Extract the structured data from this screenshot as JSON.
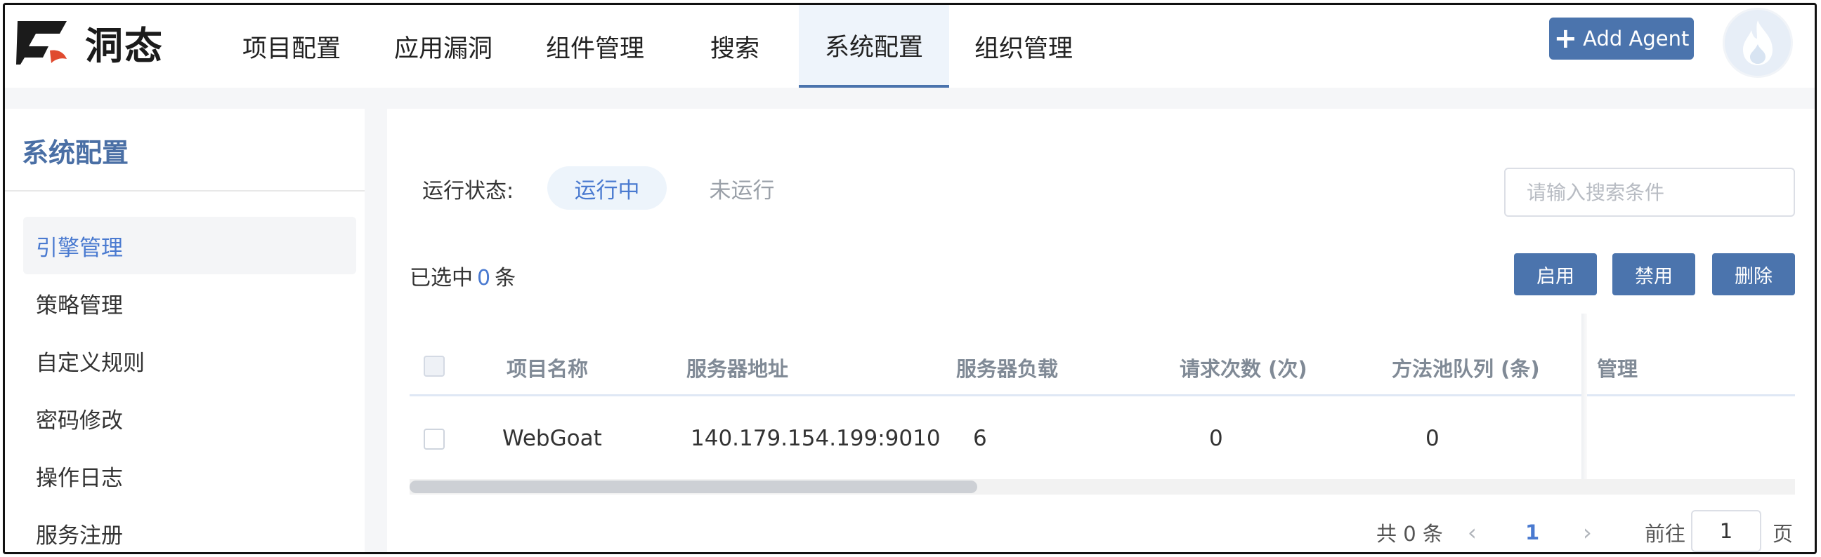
{
  "header": {
    "logo_text": "洞态",
    "nav": [
      {
        "label": "项目配置"
      },
      {
        "label": "应用漏洞"
      },
      {
        "label": "组件管理"
      },
      {
        "label": "搜索"
      },
      {
        "label": "系统配置",
        "active": true
      },
      {
        "label": "组织管理"
      }
    ],
    "add_agent_icon": "plus-icon",
    "add_agent_label": "Add Agent",
    "avatar_icon": "flame-icon"
  },
  "sidebar": {
    "title": "系统配置",
    "items": [
      {
        "label": "引擎管理",
        "active": true
      },
      {
        "label": "策略管理"
      },
      {
        "label": "自定义规则"
      },
      {
        "label": "密码修改"
      },
      {
        "label": "操作日志"
      },
      {
        "label": "服务注册"
      }
    ]
  },
  "filter": {
    "status_label": "运行状态:",
    "status_running": "运行中",
    "status_stopped": "未运行",
    "search_placeholder": "请输入搜索条件"
  },
  "selection": {
    "prefix": "已选中",
    "count": "0",
    "suffix": "条"
  },
  "actions": {
    "enable": "启用",
    "disable": "禁用",
    "delete": "删除"
  },
  "table": {
    "columns": [
      "项目名称",
      "服务器地址",
      "服务器负载",
      "请求次数 (次)",
      "方法池队列 (条)",
      "管理"
    ],
    "rows": [
      {
        "name": "WebGoat",
        "address": "140.179.154.199:9010",
        "load": "6",
        "requests": "0",
        "queue": "0"
      }
    ]
  },
  "pagination": {
    "total": "共 0 条",
    "prev_icon": "chevron-left-icon",
    "current_page": "1",
    "next_icon": "chevron-right-icon",
    "goto_label": "前往",
    "goto_value": "1",
    "page_suffix": "页"
  },
  "colors": {
    "accent": "#4b74ad",
    "link_blue": "#4a7ad0",
    "active_bg": "#eef4fb"
  }
}
